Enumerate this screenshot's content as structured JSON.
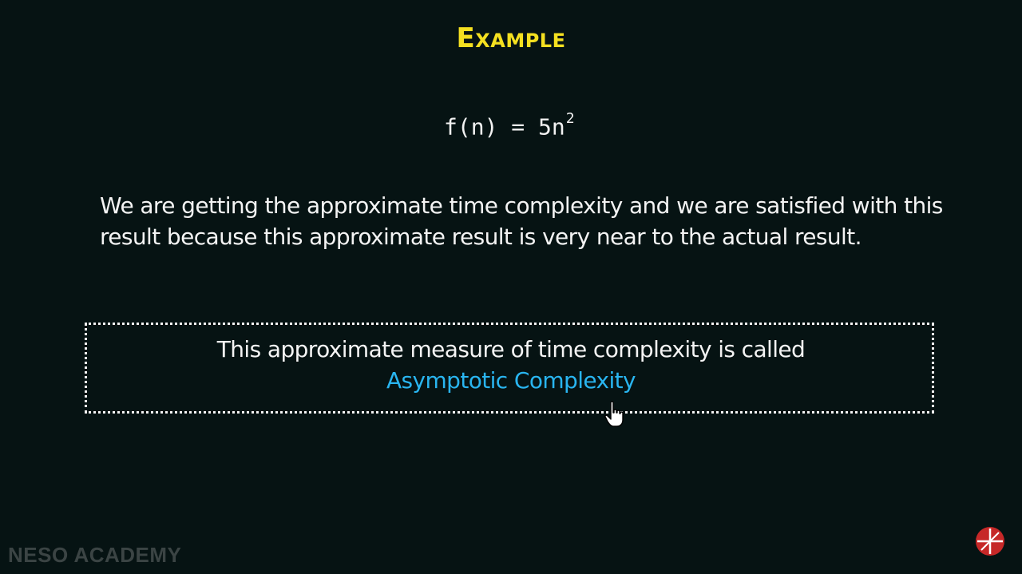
{
  "slide": {
    "title": "Example",
    "formula": {
      "lhs": "f(n) = 5n",
      "exponent": "2"
    },
    "paragraph": "We are getting the approximate time complexity and we are satisfied with this result because this approximate result is very near to the actual result.",
    "callout": {
      "text": "This approximate measure of time complexity is called",
      "term": "Asymptotic Complexity"
    }
  },
  "branding": {
    "watermark": "NESO ACADEMY"
  },
  "colors": {
    "background": "#061313",
    "title": "#f4e020",
    "highlight": "#29b5f0",
    "logo": "#c62828"
  },
  "icons": {
    "cursor": "hand-pointer-icon",
    "logo": "neso-logo-icon"
  }
}
